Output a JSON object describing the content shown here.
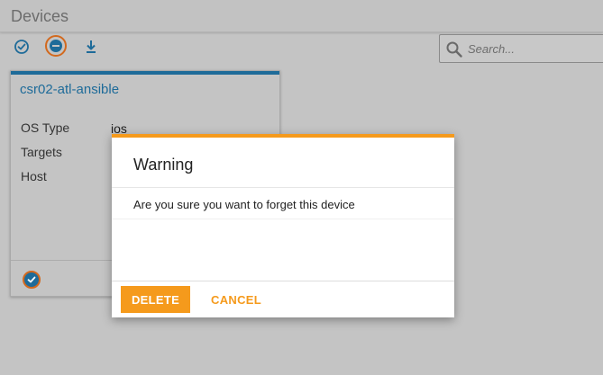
{
  "header": {
    "title": "Devices"
  },
  "toolbar": {
    "select_all_icon": "check-circle-icon",
    "forget_icon": "minus-circle-icon",
    "download_icon": "download-icon"
  },
  "search": {
    "placeholder": "Search...",
    "value": ""
  },
  "device_card": {
    "title": "csr02-atl-ansible",
    "fields": [
      {
        "label": "OS Type",
        "value": "ios"
      },
      {
        "label": "Targets",
        "value": ""
      },
      {
        "label": "Host",
        "value": ""
      }
    ],
    "selected": true
  },
  "dialog": {
    "title": "Warning",
    "message": "Are you sure you want to forget this device",
    "delete_label": "DELETE",
    "cancel_label": "CANCEL"
  },
  "colors": {
    "accent_blue": "#1e6b99",
    "accent_orange": "#f59a1c",
    "overlay_gray": "#c4c4c4"
  }
}
